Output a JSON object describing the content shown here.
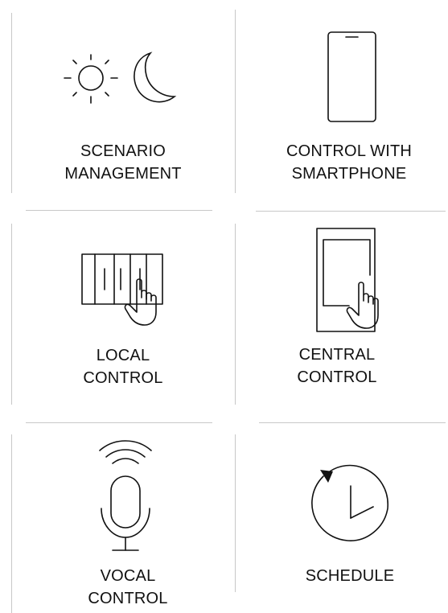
{
  "features": [
    {
      "icon": "sun-moon-icon",
      "label_line1": "SCENARIO",
      "label_line2": "MANAGEMENT"
    },
    {
      "icon": "smartphone-icon",
      "label_line1": "CONTROL WITH",
      "label_line2": "SMARTPHONE"
    },
    {
      "icon": "wall-switch-touch-icon",
      "label_line1": "LOCAL",
      "label_line2": "CONTROL"
    },
    {
      "icon": "tablet-touch-icon",
      "label_line1": "CENTRAL",
      "label_line2": "CONTROL"
    },
    {
      "icon": "voice-microphone-icon",
      "label_line1": "VOCAL",
      "label_line2": "CONTROL"
    },
    {
      "icon": "clock-icon",
      "label_line1": "SCHEDULE",
      "label_line2": ""
    }
  ],
  "colors": {
    "text": "#111111",
    "icon_stroke": "#111111",
    "divider": "#c8c8c8",
    "background": "#ffffff"
  }
}
